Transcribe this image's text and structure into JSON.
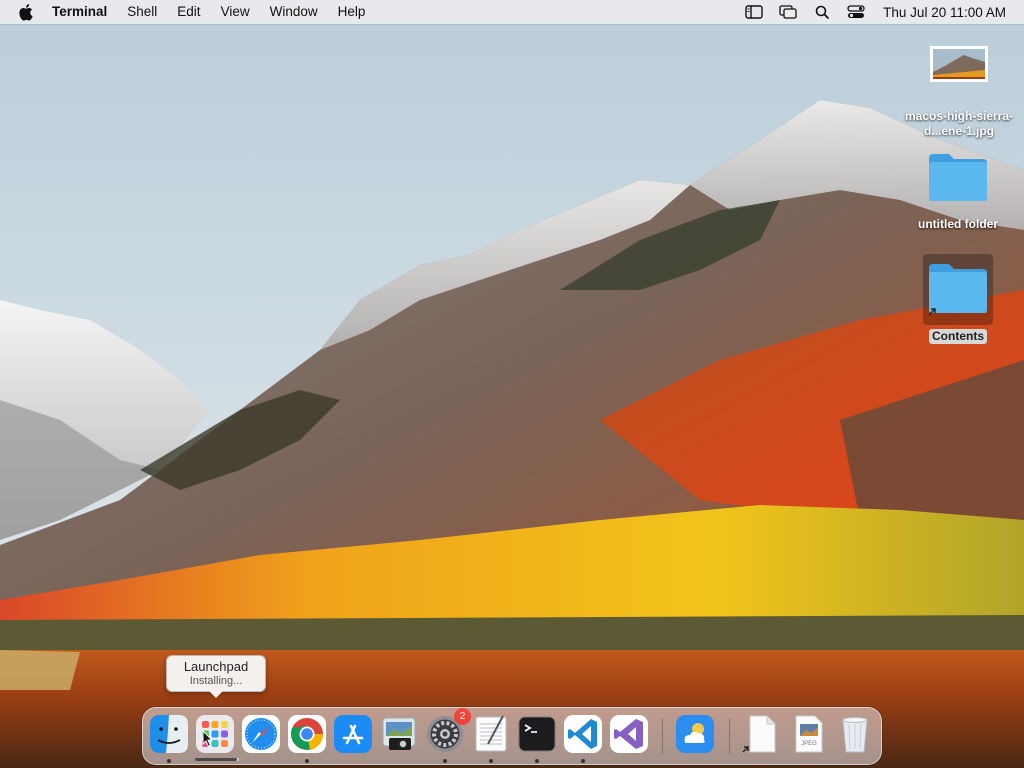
{
  "menubar": {
    "app_name": "Terminal",
    "menus": [
      "Shell",
      "Edit",
      "View",
      "Window",
      "Help"
    ],
    "clock": "Thu Jul 20  11:00 AM",
    "status_icons": [
      "sidebar-icon",
      "screen-mirroring-icon",
      "search-icon",
      "control-center-icon"
    ]
  },
  "desktop": {
    "icons": [
      {
        "label": "macos-high-sierra-d...ene-1.jpg",
        "icon": "image-thumbnail-icon"
      },
      {
        "label": "untitled folder",
        "icon": "folder-icon"
      },
      {
        "label": "Contents",
        "icon": "folder-alias-icon",
        "selected": true
      }
    ]
  },
  "tooltip": {
    "title": "Launchpad",
    "subtitle": "Installing..."
  },
  "dock": {
    "items": [
      {
        "name": "finder",
        "icon": "finder-icon",
        "running": true
      },
      {
        "name": "launchpad",
        "icon": "launchpad-icon",
        "running": false,
        "progress": 0.95
      },
      {
        "name": "safari",
        "icon": "safari-icon",
        "running": false
      },
      {
        "name": "chrome",
        "icon": "chrome-icon",
        "running": true
      },
      {
        "name": "app-store",
        "icon": "app-store-icon",
        "running": false
      },
      {
        "name": "preview",
        "icon": "preview-icon",
        "running": false
      },
      {
        "name": "system-preferences",
        "icon": "gear-icon",
        "running": true,
        "badge": "2"
      },
      {
        "name": "textedit",
        "icon": "textedit-icon",
        "running": true
      },
      {
        "name": "terminal",
        "icon": "terminal-icon",
        "running": true
      },
      {
        "name": "vscode",
        "icon": "vscode-icon",
        "running": true
      },
      {
        "name": "visual-studio",
        "icon": "visual-studio-icon",
        "running": false
      },
      {
        "name": "weather",
        "icon": "weather-icon",
        "running": false
      },
      {
        "name": "document",
        "icon": "document-alias-icon",
        "running": false
      },
      {
        "name": "jpeg-file",
        "icon": "jpeg-file-icon",
        "running": false
      },
      {
        "name": "trash",
        "icon": "trash-icon",
        "running": false
      }
    ]
  },
  "colors": {
    "folder_blue": "#5ab8ef",
    "badge_red": "#f0443a",
    "menubar_bg": "#ececee"
  }
}
